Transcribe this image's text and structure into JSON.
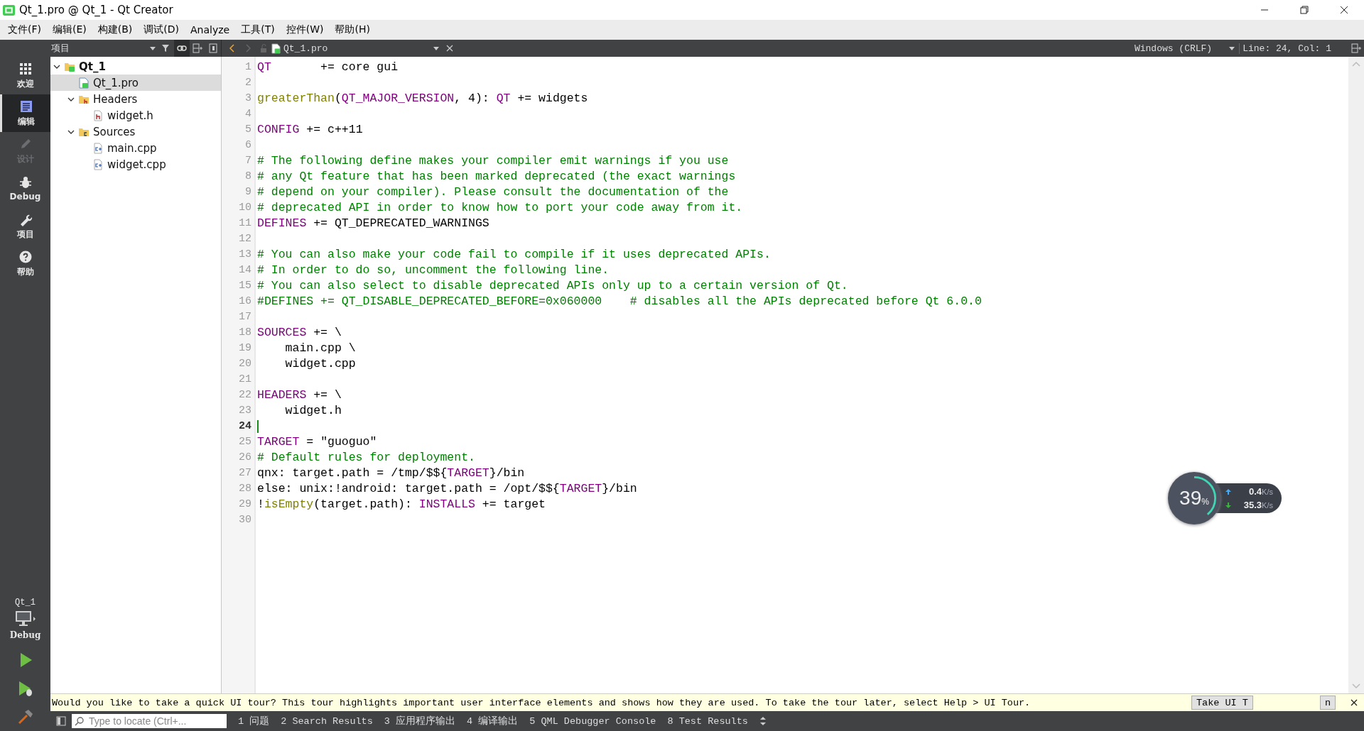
{
  "window": {
    "title": "Qt_1.pro @ Qt_1 - Qt Creator"
  },
  "menu": [
    "文件(F)",
    "编辑(E)",
    "构建(B)",
    "调试(D)",
    "Analyze",
    "工具(T)",
    "控件(W)",
    "帮助(H)"
  ],
  "modes": [
    {
      "label": "欢迎",
      "kind": "welcome",
      "selected": false,
      "disabled": false
    },
    {
      "label": "编辑",
      "kind": "edit",
      "selected": true,
      "disabled": false
    },
    {
      "label": "设计",
      "kind": "design",
      "selected": false,
      "disabled": true
    },
    {
      "label": "Debug",
      "kind": "debug",
      "selected": false,
      "disabled": false
    },
    {
      "label": "项目",
      "kind": "projects",
      "selected": false,
      "disabled": false
    },
    {
      "label": "帮助",
      "kind": "help",
      "selected": false,
      "disabled": false
    }
  ],
  "kit": {
    "project": "Qt_1",
    "build": "Debug"
  },
  "project_pane": {
    "title": "项目",
    "tree": [
      {
        "label": "Qt_1",
        "kind": "project",
        "expanded": true,
        "selected": false,
        "children": [
          {
            "label": "Qt_1.pro",
            "kind": "profile",
            "selected": true
          },
          {
            "label": "Headers",
            "kind": "headers",
            "expanded": true,
            "selected": false,
            "children": [
              {
                "label": "widget.h",
                "kind": "header",
                "selected": false
              }
            ]
          },
          {
            "label": "Sources",
            "kind": "sources",
            "expanded": true,
            "selected": false,
            "children": [
              {
                "label": "main.cpp",
                "kind": "source",
                "selected": false
              },
              {
                "label": "widget.cpp",
                "kind": "source",
                "selected": false
              }
            ]
          }
        ]
      }
    ]
  },
  "editor": {
    "tab": "Qt_1.pro",
    "line_ending": "Windows (CRLF)",
    "position": "Line: 24, Col: 1",
    "lines": [
      {
        "number": "1",
        "current": false,
        "tokens": [
          {
            "text": "QT",
            "kind": "kw"
          },
          {
            "text": "       += core gui",
            "kind": "txt"
          }
        ]
      },
      {
        "number": "2",
        "current": false
      },
      {
        "number": "3",
        "current": false,
        "tokens": [
          {
            "text": "greaterThan",
            "kind": "fn"
          },
          {
            "text": "(",
            "kind": "txt"
          },
          {
            "text": "QT_MAJOR_VERSION",
            "kind": "kw"
          },
          {
            "text": ", 4): ",
            "kind": "txt"
          },
          {
            "text": "QT",
            "kind": "kw"
          },
          {
            "text": " += widgets",
            "kind": "txt"
          }
        ]
      },
      {
        "number": "4",
        "current": false
      },
      {
        "number": "5",
        "current": false,
        "tokens": [
          {
            "text": "CONFIG",
            "kind": "kw"
          },
          {
            "text": " += c++11",
            "kind": "txt"
          }
        ]
      },
      {
        "number": "6",
        "current": false
      },
      {
        "number": "7",
        "current": false,
        "tokens": [
          {
            "text": "# The following define makes your compiler emit warnings if you use",
            "kind": "cm"
          }
        ]
      },
      {
        "number": "8",
        "current": false,
        "tokens": [
          {
            "text": "# any Qt feature that has been marked deprecated (the exact warnings",
            "kind": "cm"
          }
        ]
      },
      {
        "number": "9",
        "current": false,
        "tokens": [
          {
            "text": "# depend on your compiler). Please consult the documentation of the",
            "kind": "cm"
          }
        ]
      },
      {
        "number": "10",
        "current": false,
        "tokens": [
          {
            "text": "# deprecated API in order to know how to port your code away from it.",
            "kind": "cm"
          }
        ]
      },
      {
        "number": "11",
        "current": false,
        "tokens": [
          {
            "text": "DEFINES",
            "kind": "kw"
          },
          {
            "text": " += QT_DEPRECATED_WARNINGS",
            "kind": "txt"
          }
        ]
      },
      {
        "number": "12",
        "current": false
      },
      {
        "number": "13",
        "current": false,
        "tokens": [
          {
            "text": "# You can also make your code fail to compile if it uses deprecated APIs.",
            "kind": "cm"
          }
        ]
      },
      {
        "number": "14",
        "current": false,
        "tokens": [
          {
            "text": "# In order to do so, uncomment the following line.",
            "kind": "cm"
          }
        ]
      },
      {
        "number": "15",
        "current": false,
        "tokens": [
          {
            "text": "# You can also select to disable deprecated APIs only up to a certain version of Qt.",
            "kind": "cm"
          }
        ]
      },
      {
        "number": "16",
        "current": false,
        "tokens": [
          {
            "text": "#DEFINES += QT_DISABLE_DEPRECATED_BEFORE=0x060000    # disables all the APIs deprecated before Qt 6.0.0",
            "kind": "cm"
          }
        ]
      },
      {
        "number": "17",
        "current": false
      },
      {
        "number": "18",
        "current": false,
        "tokens": [
          {
            "text": "SOURCES",
            "kind": "kw"
          },
          {
            "text": " += \\",
            "kind": "txt"
          }
        ]
      },
      {
        "number": "19",
        "current": false,
        "tokens": [
          {
            "text": "    main.cpp \\",
            "kind": "txt"
          }
        ]
      },
      {
        "number": "20",
        "current": false,
        "tokens": [
          {
            "text": "    widget.cpp",
            "kind": "txt"
          }
        ]
      },
      {
        "number": "21",
        "current": false
      },
      {
        "number": "22",
        "current": false,
        "tokens": [
          {
            "text": "HEADERS",
            "kind": "kw"
          },
          {
            "text": " += \\",
            "kind": "txt"
          }
        ]
      },
      {
        "number": "23",
        "current": false,
        "tokens": [
          {
            "text": "    widget.h",
            "kind": "txt"
          }
        ]
      },
      {
        "number": "24",
        "current": true
      },
      {
        "number": "25",
        "current": false,
        "tokens": [
          {
            "text": "TARGET",
            "kind": "kw"
          },
          {
            "text": " = \"guoguo\"",
            "kind": "txt"
          }
        ]
      },
      {
        "number": "26",
        "current": false,
        "tokens": [
          {
            "text": "# Default rules for deployment.",
            "kind": "cm"
          }
        ]
      },
      {
        "number": "27",
        "current": false,
        "tokens": [
          {
            "text": "qnx: target.path = /tmp/$${",
            "kind": "txt"
          },
          {
            "text": "TARGET",
            "kind": "kw"
          },
          {
            "text": "}/bin",
            "kind": "txt"
          }
        ]
      },
      {
        "number": "28",
        "current": false,
        "tokens": [
          {
            "text": "else: unix:!android: target.path = /opt/$${",
            "kind": "txt"
          },
          {
            "text": "TARGET",
            "kind": "kw"
          },
          {
            "text": "}/bin",
            "kind": "txt"
          }
        ]
      },
      {
        "number": "29",
        "current": false,
        "tokens": [
          {
            "text": "!",
            "kind": "txt"
          },
          {
            "text": "isEmpty",
            "kind": "fn"
          },
          {
            "text": "(target.path): ",
            "kind": "txt"
          },
          {
            "text": "INSTALLS",
            "kind": "kw"
          },
          {
            "text": " += target",
            "kind": "txt"
          }
        ]
      },
      {
        "number": "30",
        "current": false
      }
    ]
  },
  "info_bar": {
    "text": "Would you like to take a quick UI tour? This tour highlights important user interface elements and shows how they are used. To take the tour later, select Help > UI Tour.",
    "buttons": [
      "Take UI T",
      "n"
    ]
  },
  "locator": {
    "placeholder": "Type to locate (Ctrl+..."
  },
  "output_tabs": [
    "1 问题",
    "2 Search Results",
    "3 应用程序输出",
    "4 编译输出",
    "5 QML Debugger Console",
    "8 Test Results"
  ],
  "net_meter": {
    "percent": "39",
    "percent_unit": "%",
    "upload": {
      "value": "0.4",
      "unit": "K/s"
    },
    "download": {
      "value": "35.3",
      "unit": "K/s"
    }
  }
}
